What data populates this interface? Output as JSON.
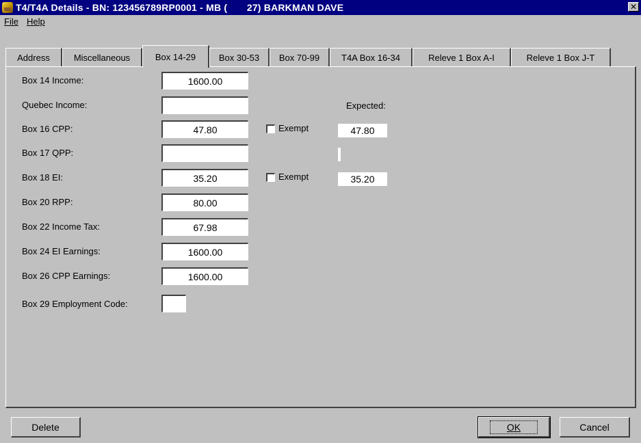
{
  "window": {
    "title": "T4/T4A Details - BN: 123456789RP0001 - MB (       27) BARKMAN DAVE",
    "close_glyph": "✕"
  },
  "menu": {
    "file": "File",
    "help": "Help"
  },
  "tabs": [
    {
      "label": "Address",
      "active": false
    },
    {
      "label": "Miscellaneous",
      "active": false
    },
    {
      "label": "Box 14-29",
      "active": true
    },
    {
      "label": "Box 30-53",
      "active": false
    },
    {
      "label": "Box 70-99",
      "active": false
    },
    {
      "label": "T4A Box 16-34",
      "active": false
    },
    {
      "label": "Releve 1 Box A-I",
      "active": false
    },
    {
      "label": "Releve 1 Box J-T",
      "active": false
    }
  ],
  "fields": {
    "box14": {
      "label": "Box 14 Income:",
      "value": "1600.00"
    },
    "quebec": {
      "label": "Quebec Income:",
      "value": ""
    },
    "box16": {
      "label": "Box 16 CPP:",
      "value": "47.80"
    },
    "box17": {
      "label": "Box 17 QPP:",
      "value": ""
    },
    "box18": {
      "label": "Box 18 EI:",
      "value": "35.20"
    },
    "box20": {
      "label": "Box 20 RPP:",
      "value": "80.00"
    },
    "box22": {
      "label": "Box 22 Income Tax:",
      "value": "67.98"
    },
    "box24": {
      "label": "Box 24 EI Earnings:",
      "value": "1600.00"
    },
    "box26": {
      "label": "Box 26 CPP Earnings:",
      "value": "1600.00"
    },
    "box29": {
      "label": "Box 29 Employment Code:",
      "value": ""
    }
  },
  "expected": {
    "heading": "Expected:",
    "cpp": "47.80",
    "qpp": "",
    "ei": "35.20"
  },
  "exempt": {
    "cpp_label": "Exempt",
    "cpp_checked": false,
    "ei_label": "Exempt",
    "ei_checked": false
  },
  "buttons": {
    "delete": "Delete",
    "ok": "OK",
    "cancel": "Cancel"
  },
  "icons": {
    "app": "cash-register-icon",
    "close": "close-icon"
  }
}
